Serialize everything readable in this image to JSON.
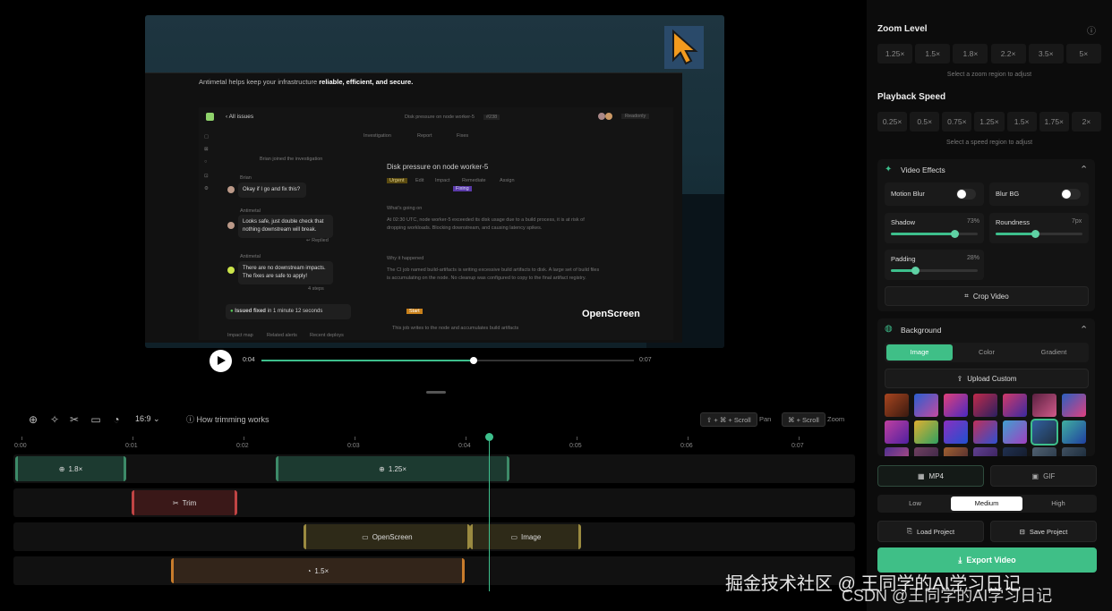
{
  "preview": {
    "tagline_pre": "Antimetal helps keep your infrastructure ",
    "tagline_bold": "reliable, efficient, and secure.",
    "brand": "OpenScreen",
    "app": {
      "all_issues": "All issues",
      "issue_header": "Disk pressure on node worker-5",
      "issue_id": "#238",
      "topbar": [
        "Investigation",
        "Report",
        "Fixes"
      ],
      "issue_title": "Disk pressure on node worker-5",
      "chips": [
        "Urgent",
        "Edit",
        "Impact",
        "Remediate",
        "Assign"
      ],
      "fixing_badge": "Fixing",
      "left_tool_btn": "Readonly",
      "joined": "Brian joined the investigation",
      "msgs": [
        {
          "who": "Brian",
          "text": "Okay if I go and fix this?"
        },
        {
          "who": "Antimetal",
          "text": "Looks safe, just double check that nothing downstream will break."
        },
        {
          "who": "Antimetal",
          "text": "There are no downstream impacts. The fixes are safe to apply!"
        }
      ],
      "replied": "Replied",
      "steps": "4 steps",
      "issue_fixed_pre": "Issued fixed",
      "issue_fixed_post": " in 1 minute 12 seconds",
      "footer_items": [
        "Impact map",
        "Related alerts",
        "Recent deploys"
      ],
      "going_on": "What's going on",
      "going_on_text": "At 02:30 UTC, node  worker-5  exceeded its disk usage due to a build process, it is at risk of dropping workloads. Blocking downstream, and causing latency spikes.",
      "why": "Why it happened",
      "why_text": "The CI job named  build-artifacts  is writing excessive build artifacts to disk. A large set of build files is accumulating on the node. No cleanup was configured to copy to the final artifact registry.",
      "start_badge": "Start",
      "bottom_note": "This job writes to the node and accumulates build artifacts"
    }
  },
  "player": {
    "current": "0:04",
    "duration": "0:07",
    "progress": 0.57
  },
  "toolbar": {
    "ratio": "16:9",
    "how_trimming": "How trimming works",
    "pan_keys": "⇧ + ⌘ + Scroll",
    "pan": "Pan",
    "zoom_keys": "⌘ + Scroll",
    "zoom": "Zoom"
  },
  "timeline": {
    "ticks": [
      "0:00",
      "0:01",
      "0:02",
      "0:03",
      "0:04",
      "0:05",
      "0:06",
      "0:07"
    ],
    "playhead_sec": 4.26,
    "zoom_clips": [
      {
        "label": "1.8×",
        "start": 0.0,
        "end": 1.0
      },
      {
        "label": "1.25×",
        "start": 2.35,
        "end": 4.45
      }
    ],
    "trim_clips": [
      {
        "label": "Trim",
        "start": 1.05,
        "end": 2.0
      }
    ],
    "annotation_clips": [
      {
        "label": "OpenScreen",
        "start": 2.6,
        "end": 4.1
      },
      {
        "label": "Image",
        "start": 4.1,
        "end": 5.1
      }
    ],
    "speed_clips": [
      {
        "label": "1.5×",
        "start": 1.4,
        "end": 4.05
      }
    ]
  },
  "sidebar": {
    "zoom_title": "Zoom Level",
    "zoom_levels": [
      "1.25×",
      "1.5×",
      "1.8×",
      "2.2×",
      "3.5×",
      "5×"
    ],
    "zoom_hint": "Select a zoom region to adjust",
    "speed_title": "Playback Speed",
    "speeds": [
      "0.25×",
      "0.5×",
      "0.75×",
      "1.25×",
      "1.5×",
      "1.75×",
      "2×"
    ],
    "speed_hint": "Select a speed region to adjust",
    "effects_title": "Video Effects",
    "motion_blur": "Motion Blur",
    "blur_bg": "Blur BG",
    "shadow": {
      "label": "Shadow",
      "value": "73%",
      "level": 0.73
    },
    "roundness": {
      "label": "Roundness",
      "value": "7px",
      "level": 0.45
    },
    "padding": {
      "label": "Padding",
      "value": "28%",
      "level": 0.28
    },
    "crop": "Crop Video",
    "bg_title": "Background",
    "bg_tabs": [
      "Image",
      "Color",
      "Gradient"
    ],
    "upload": "Upload Custom",
    "formats": [
      "MP4",
      "GIF"
    ],
    "qualities": [
      "Low",
      "Medium",
      "High"
    ],
    "load": "Load Project",
    "save": "Save Project",
    "export": "Export Video"
  },
  "watermarks": [
    "掘金技术社区 @ 王同学的AI学习日记",
    "CSDN @王同学的AI学习日记"
  ],
  "colors": {
    "accent": "#3dbf8c",
    "zoom": "#3d8a68",
    "trim": "#c04444",
    "annotation": "#9a8a40",
    "speed": "#c87c2c"
  }
}
